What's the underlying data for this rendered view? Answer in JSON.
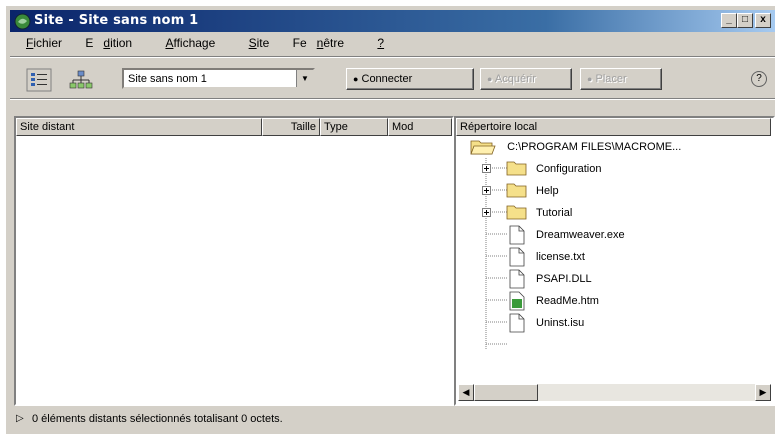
{
  "window": {
    "title": "Site - Site sans nom 1",
    "minimize": "_",
    "maximize": "□",
    "close": "x"
  },
  "menu": [
    {
      "pre": "",
      "key": "F",
      "post": "ichier"
    },
    {
      "pre": "E",
      "key": "d",
      "post": "ition"
    },
    {
      "pre": "",
      "key": "A",
      "post": "ffichage"
    },
    {
      "pre": "",
      "key": "S",
      "post": "ite"
    },
    {
      "pre": "Fe",
      "key": "n",
      "post": "être"
    },
    {
      "pre": "",
      "key": "?",
      "post": ""
    }
  ],
  "toolbar": {
    "site_select": "Site sans nom 1",
    "connect_label": "Connecter",
    "get_label": "Acquérir",
    "put_label": "Placer",
    "help_label": "?"
  },
  "remote_pane": {
    "columns": [
      "Site distant",
      "Taille",
      "Type",
      "Mod"
    ]
  },
  "local_pane": {
    "header": "Répertoire local",
    "root": "C:\\PROGRAM FILES\\MACROME...",
    "items": [
      {
        "name": "Configuration",
        "kind": "folder"
      },
      {
        "name": "Help",
        "kind": "folder"
      },
      {
        "name": "Tutorial",
        "kind": "folder"
      },
      {
        "name": "Dreamweaver.exe",
        "kind": "file"
      },
      {
        "name": "license.txt",
        "kind": "file"
      },
      {
        "name": "PSAPI.DLL",
        "kind": "file"
      },
      {
        "name": "ReadMe.htm",
        "kind": "html"
      },
      {
        "name": "Uninst.isu",
        "kind": "file"
      }
    ]
  },
  "status": {
    "text": "0 éléments distants sélectionnés totalisant 0 octets."
  }
}
